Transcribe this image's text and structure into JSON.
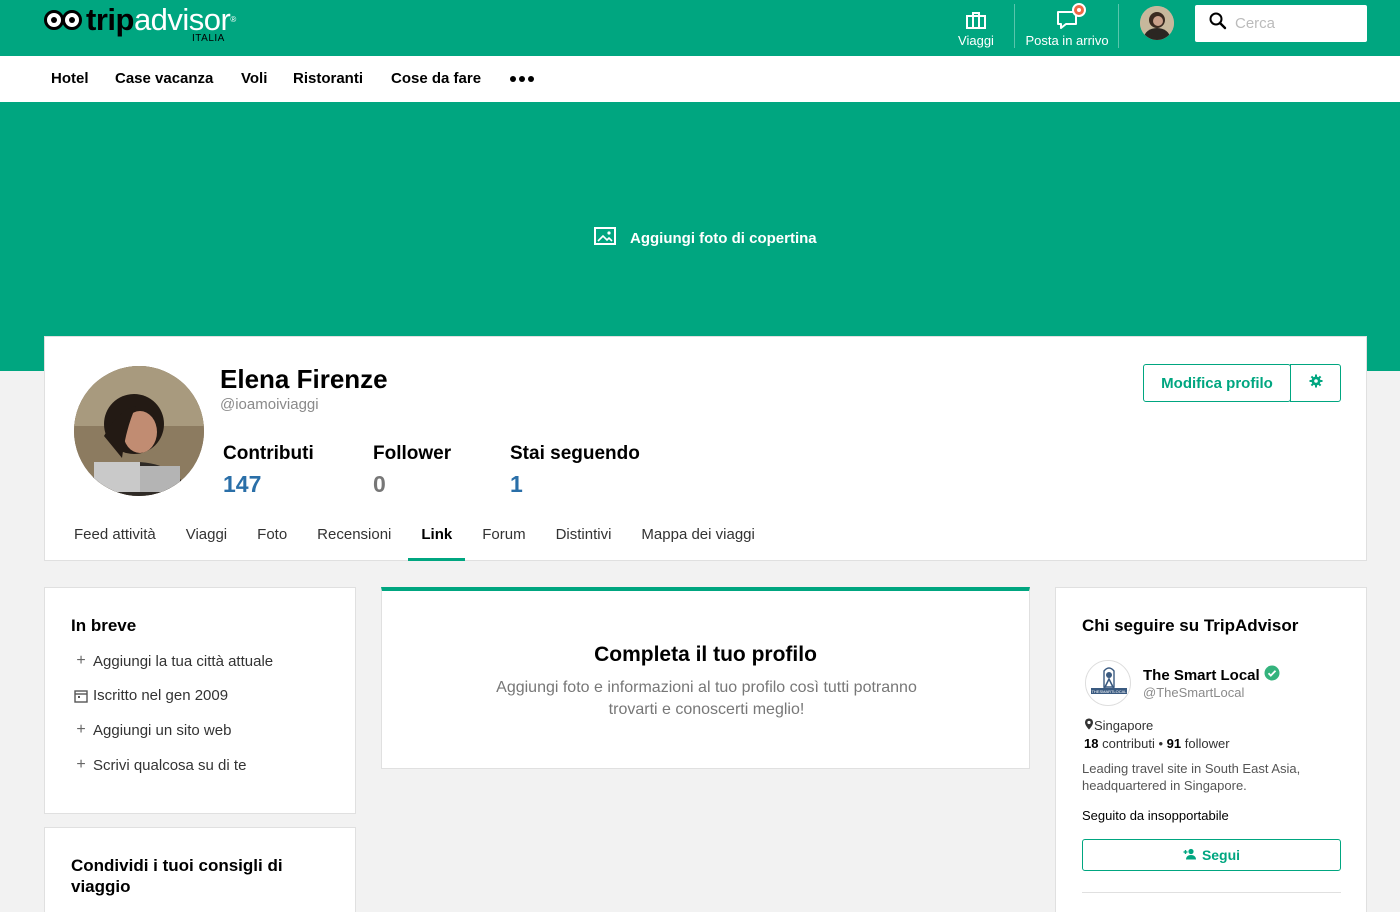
{
  "brand": {
    "name_part1": "trip",
    "name_part2": "advisor",
    "region": "ITALIA",
    "reg": "®",
    "color": "#00a680"
  },
  "topnav": {
    "trips_label": "Viaggi",
    "inbox_label": "Posta in arrivo",
    "search_placeholder": "Cerca"
  },
  "menu": [
    "Hotel",
    "Case vacanza",
    "Voli",
    "Ristoranti",
    "Cose da fare"
  ],
  "cover": {
    "add_label": "Aggiungi foto di copertina"
  },
  "profile": {
    "name": "Elena Firenze",
    "handle": "@ioamoiviaggi",
    "edit_label": "Modifica profilo",
    "stats": [
      {
        "label": "Contributi",
        "value": "147",
        "color": "#2a6fa8"
      },
      {
        "label": "Follower",
        "value": "0",
        "color": "#777777"
      },
      {
        "label": "Stai seguendo",
        "value": "1",
        "color": "#2a6fa8"
      }
    ],
    "tabs": [
      "Feed attività",
      "Viaggi",
      "Foto",
      "Recensioni",
      "Link",
      "Forum",
      "Distintivi",
      "Mappa dei viaggi"
    ],
    "active_tab": "Link"
  },
  "brief": {
    "title": "In breve",
    "items": [
      {
        "icon": "plus-icon",
        "text": "Aggiungi la tua città attuale"
      },
      {
        "icon": "calendar-icon",
        "text": "Iscritto nel gen 2009"
      },
      {
        "icon": "plus-icon",
        "text": "Aggiungi un sito web"
      },
      {
        "icon": "plus-icon",
        "text": "Scrivi qualcosa su di te"
      }
    ]
  },
  "share": {
    "title": "Condividi i tuoi consigli di viaggio"
  },
  "complete": {
    "title": "Completa il tuo profilo",
    "text": "Aggiungi foto e informazioni al tuo profilo così tutti potranno trovarti e conoscerti meglio!"
  },
  "suggest": {
    "title": "Chi seguire su TripAdvisor",
    "name": "The Smart Local",
    "handle": "@TheSmartLocal",
    "location": "Singapore",
    "contrib_count": "18",
    "contrib_label": "contributi",
    "sep": "•",
    "follower_count": "91",
    "follower_label": "follower",
    "desc": "Leading travel site in South East Asia, headquartered in Singapore.",
    "followed_by": "Seguito da insopportabile",
    "follow_label": "Segui",
    "avatar_text": "THESMARTLOCAL"
  }
}
